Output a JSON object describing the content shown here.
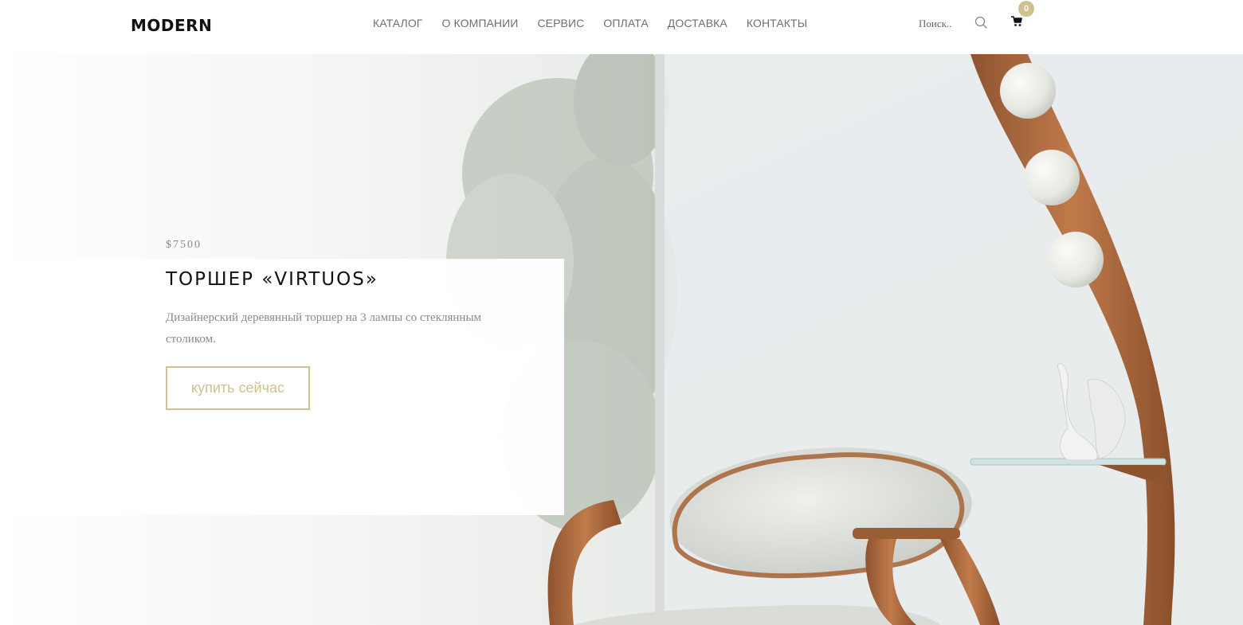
{
  "brand": {
    "logo": "MODERN"
  },
  "nav": {
    "items": [
      {
        "label": "КАТАЛОГ"
      },
      {
        "label": "О КОМПАНИИ"
      },
      {
        "label": "СЕРВИС"
      },
      {
        "label": "ОПЛАТА"
      },
      {
        "label": "ДОСТАВКА"
      },
      {
        "label": "КОНТАКТЫ"
      }
    ]
  },
  "search": {
    "placeholder": "Поиск.."
  },
  "cart": {
    "count": "0"
  },
  "hero": {
    "price": "$7500",
    "title": "ТОРШЕР «VIRTUOS»",
    "description": "Дизайнерский деревянный торшер на 3 лампы со стеклянным столиком.",
    "button_label": "купить сейчас"
  },
  "colors": {
    "accent": "#cfc290",
    "nav_text": "#6f6f6f",
    "body_text": "#8a8a8a",
    "wood": "#a9683d"
  },
  "icons": [
    "search-icon",
    "cart-icon"
  ]
}
